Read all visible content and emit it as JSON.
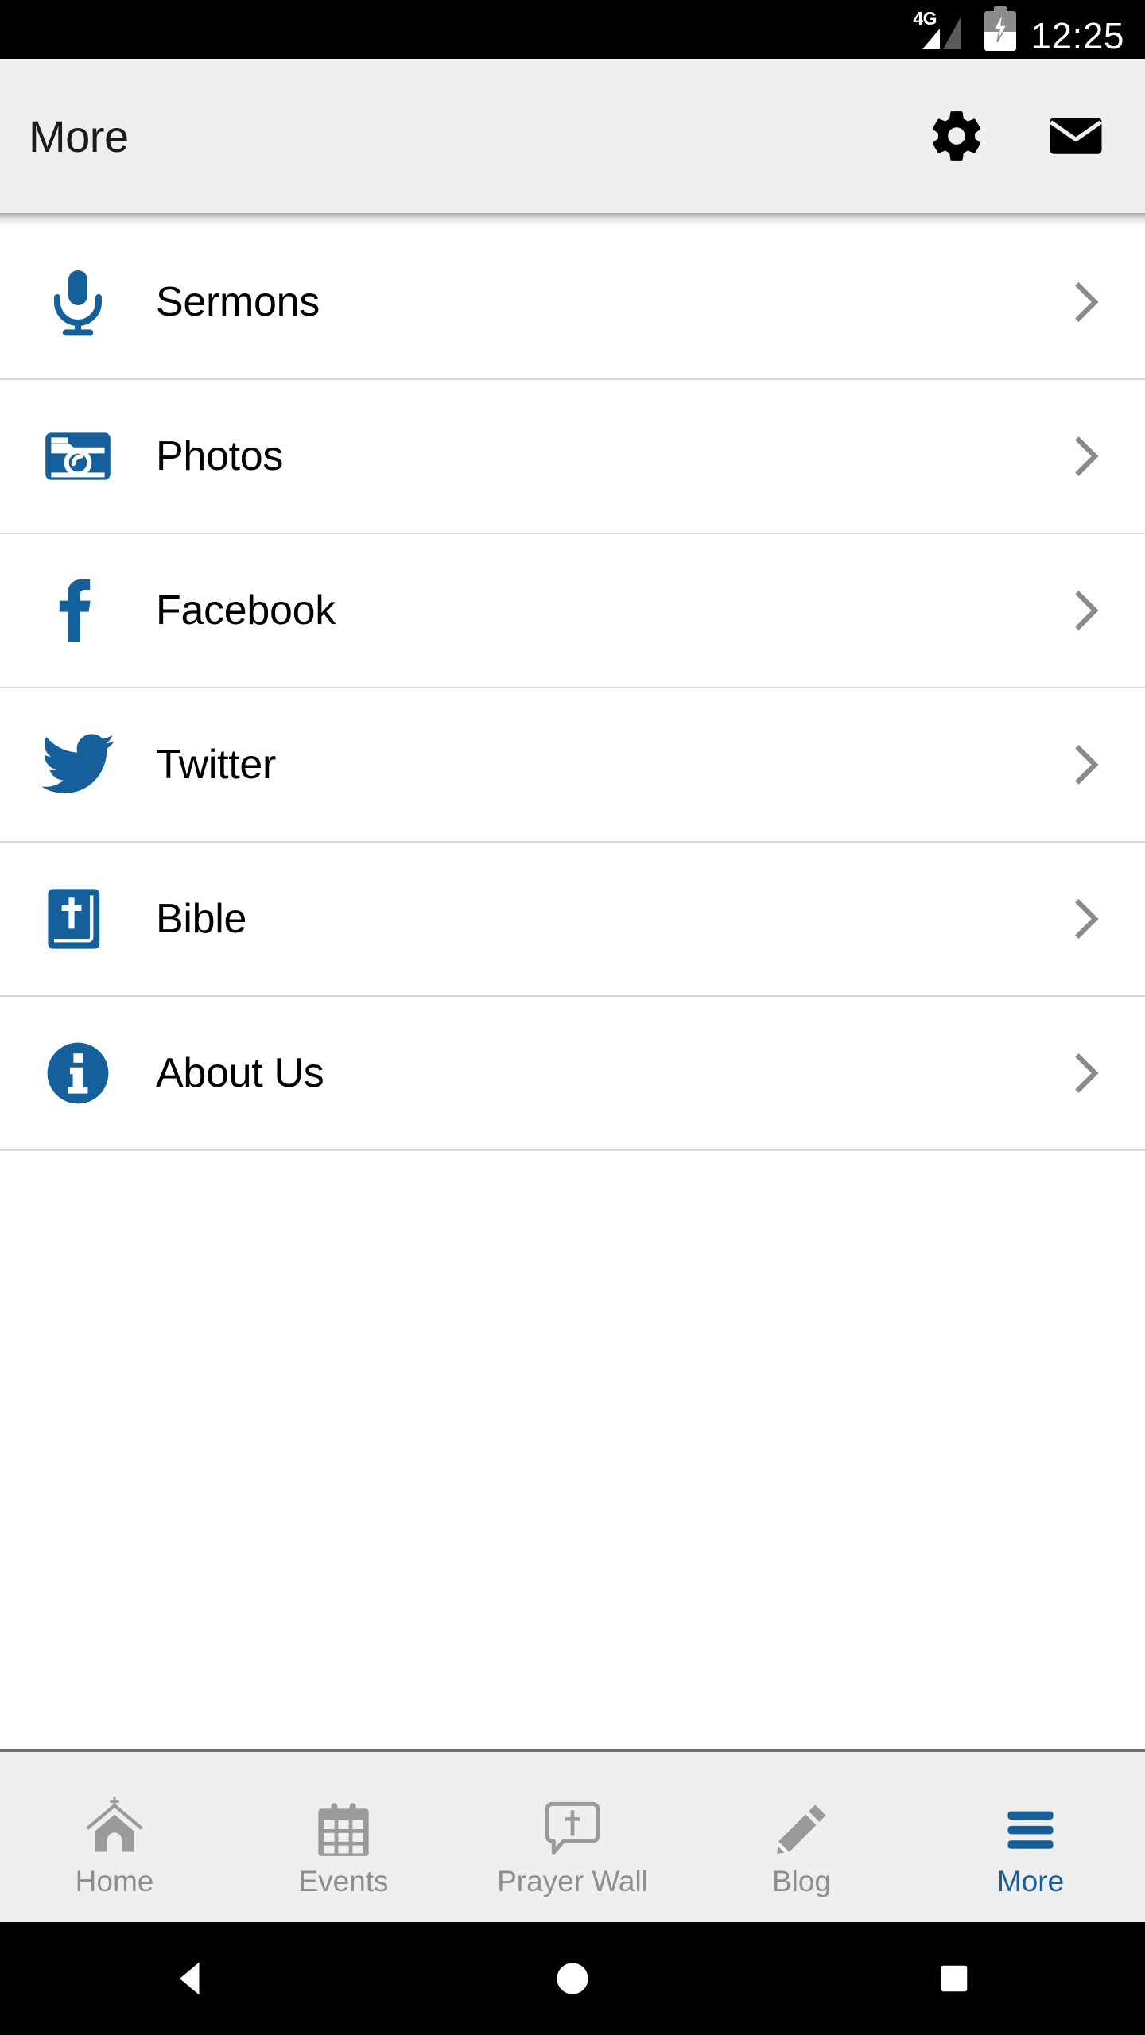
{
  "status_bar": {
    "network_label": "4G",
    "signal_icon": "signal-bars-icon",
    "battery_icon": "battery-charging-icon",
    "time": "12:25"
  },
  "header": {
    "title": "More",
    "actions": [
      {
        "name": "settings-button",
        "icon": "gear-icon"
      },
      {
        "name": "mail-button",
        "icon": "envelope-icon"
      }
    ]
  },
  "colors": {
    "accent_blue": "#15609a",
    "header_bg": "#efefef",
    "divider": "#d8d8d8",
    "inactive_tab": "#8e8e8e",
    "chevron": "#8a8a8a"
  },
  "list": {
    "items": [
      {
        "label": "Sermons",
        "icon": "microphone-icon",
        "chevron": "chevron-right-icon"
      },
      {
        "label": "Photos",
        "icon": "camera-icon",
        "chevron": "chevron-right-icon"
      },
      {
        "label": "Facebook",
        "icon": "facebook-icon",
        "chevron": "chevron-right-icon"
      },
      {
        "label": "Twitter",
        "icon": "twitter-bird-icon",
        "chevron": "chevron-right-icon"
      },
      {
        "label": "Bible",
        "icon": "bible-book-icon",
        "chevron": "chevron-right-icon"
      },
      {
        "label": "About Us",
        "icon": "info-circle-icon",
        "chevron": "chevron-right-icon"
      }
    ]
  },
  "tabbar": {
    "tabs": [
      {
        "label": "Home",
        "icon": "church-icon",
        "active": false
      },
      {
        "label": "Events",
        "icon": "calendar-icon",
        "active": false
      },
      {
        "label": "Prayer Wall",
        "icon": "speech-bubble-cross-icon",
        "active": false
      },
      {
        "label": "Blog",
        "icon": "pencil-icon",
        "active": false
      },
      {
        "label": "More",
        "icon": "hamburger-menu-icon",
        "active": true
      }
    ]
  },
  "android_nav": {
    "buttons": [
      {
        "name": "back-button",
        "icon": "triangle-back-icon"
      },
      {
        "name": "home-button",
        "icon": "circle-home-icon"
      },
      {
        "name": "recents-button",
        "icon": "square-recents-icon"
      }
    ]
  }
}
